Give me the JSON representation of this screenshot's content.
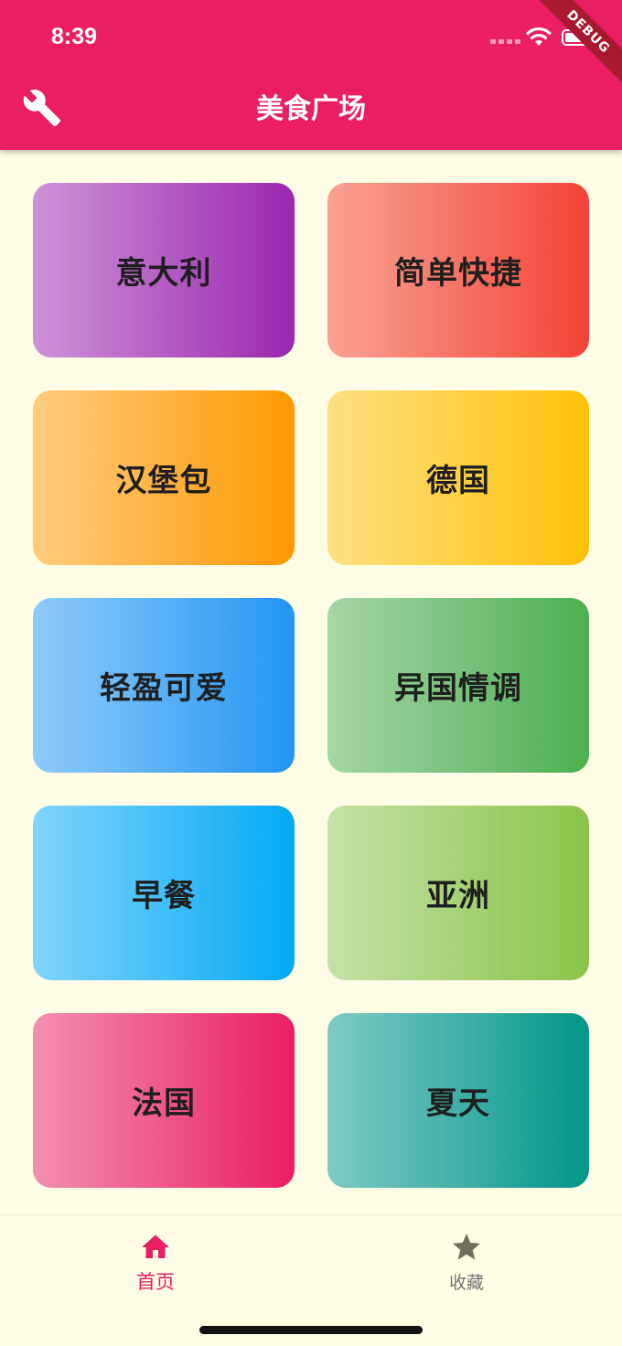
{
  "status_bar": {
    "time": "8:39"
  },
  "debug_banner": "DEBUG",
  "app_bar": {
    "title": "美食广场",
    "icon": "wrench-icon"
  },
  "categories": [
    {
      "label": "意大利",
      "color_start": "#CE93D8",
      "color_end": "#9C27B0"
    },
    {
      "label": "简单快捷",
      "color_start": "#F8A392",
      "color_end": "#F44336"
    },
    {
      "label": "汉堡包",
      "color_start": "#FFCC80",
      "color_end": "#FF9800"
    },
    {
      "label": "德国",
      "color_start": "#FFE082",
      "color_end": "#FFC107"
    },
    {
      "label": "轻盈可爱",
      "color_start": "#90CAF9",
      "color_end": "#2196F3"
    },
    {
      "label": "异国情调",
      "color_start": "#A5D6A7",
      "color_end": "#4CAF50"
    },
    {
      "label": "早餐",
      "color_start": "#81D4FA",
      "color_end": "#03A9F4"
    },
    {
      "label": "亚洲",
      "color_start": "#C5E1A5",
      "color_end": "#8BC34A"
    },
    {
      "label": "法国",
      "color_start": "#F48FB1",
      "color_end": "#E91E63"
    },
    {
      "label": "夏天",
      "color_start": "#80CBC4",
      "color_end": "#009688"
    }
  ],
  "bottom_nav": {
    "home": {
      "label": "首页",
      "icon": "home-icon",
      "active": true
    },
    "favorites": {
      "label": "收藏",
      "icon": "star-icon",
      "active": false
    }
  },
  "colors": {
    "primary": "#E91E63",
    "background": "#FFFDE5",
    "inactive": "#757575"
  }
}
